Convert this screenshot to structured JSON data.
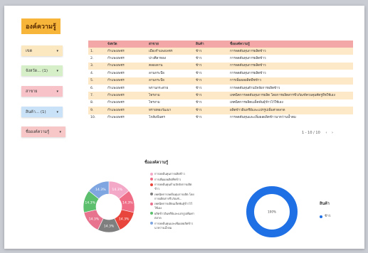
{
  "title": "องค์ความรู้",
  "filters": [
    {
      "label": "เขต",
      "bg": "#fbe7c0"
    },
    {
      "label": "จังหวัด... (1)",
      "bg": "#d7efc9"
    },
    {
      "label": "สาขาย",
      "bg": "#f7c2c8"
    },
    {
      "label": "สินค้า... (1)",
      "bg": "#c9e2f7"
    },
    {
      "label": "ชื่อองค์ความรู้",
      "bg": "#f7c7c7"
    }
  ],
  "table": {
    "headers": [
      "",
      "จังหวัด",
      "สาขาย",
      "สินค้า",
      "ชื่อองค์ความรู้"
    ],
    "rows": [
      [
        "1.",
        "กำแพงเพชร",
        "เมืองกำแพงเพชร",
        "ข้าว",
        "การลดต้นทุนการผลิตข้าว"
      ],
      [
        "2.",
        "กำแพงเพชร",
        "ปางศิลาทอง",
        "ข้าว",
        "การลดต้นทุนการผลิตข้าว"
      ],
      [
        "3.",
        "กำแพงเพชร",
        "คลองลาน",
        "ข้าว",
        "การลดต้นทุนการผลิตข้าว"
      ],
      [
        "4.",
        "กำแพงเพชร",
        "ลานกระบือ",
        "ข้าว",
        "การลดต้นทุนการผลิตข้าว"
      ],
      [
        "5.",
        "กำแพงเพชร",
        "ลานกระบือ",
        "ข้าว",
        "การเพิ่มผลผลิตพืชข้าว"
      ],
      [
        "6.",
        "กำแพงเพชร",
        "พรานกระต่าย",
        "ข้าว",
        "การลดต้นทุนด้านปัจจัยการผลิตข้าว"
      ],
      [
        "7.",
        "กำแพงเพชร",
        "ไทรงาม",
        "ข้าว",
        "เทคนิคการลดต้นทุนการผลิต โดยการผลิตสารชีวภัณฑ์ควบคุมศัตรูพืชใช้เอง"
      ],
      [
        "8.",
        "กำแพงเพชร",
        "ไทรงาม",
        "ข้าว",
        "เทคนิคการผลิตเมล็ดพันธุ์ข้าวไว้ใช้เอง"
      ],
      [
        "9.",
        "กำแพงเพชร",
        "ทรายทองวัฒนา",
        "ข้าว",
        "ผลิตข้าวอินทรีย์และแปรรูปเพิ่มค่าตลาด"
      ],
      [
        "10.",
        "กำแพงเพชร",
        "โกสัมพีนคร",
        "ข้าว",
        "การลดต้นทุนและเพิ่มผลผลิตข้าวนาหว่านน้ำตม"
      ]
    ]
  },
  "pagination": {
    "text": "1 - 10 / 10"
  },
  "pie_title": "ชื่อองค์ความรู้",
  "donut_title": "สินค้า",
  "chart_data": [
    {
      "type": "pie",
      "title": "ชื่อองค์ความรู้",
      "donut": true,
      "labels": [
        "การลดต้นทุนการผลิตข้าว",
        "การเพิ่มผลผลิตพืชข้าว",
        "การลดต้นทุนด้านปัจจัยการผลิตข้าว",
        "เทคนิคการลดต้นทุนการผลิต โดยการผลิตสารชีวภัณฑ์...",
        "เทคนิคการผลิตเมล็ดพันธุ์ข้าวไว้ใช้เอง",
        "ผลิตข้าวอินทรีย์และแปรรูปเพิ่มค่าตลาด",
        "การลดต้นทุนและเพิ่มผลผลิตข้าวนาหว่านน้ำตม"
      ],
      "values": [
        14.3,
        14.3,
        14.3,
        14.3,
        14.3,
        14.3,
        14.3
      ],
      "value_labels": [
        "14.3%",
        "14.3%",
        "14.3%",
        "14.3%",
        "14.3%",
        "14.3%",
        "14.3%"
      ],
      "colors": [
        "#f4a8c8",
        "#ef6d87",
        "#e8453c",
        "#7f7f7f",
        "#e7738e",
        "#5bbf6e",
        "#7fa6e0"
      ]
    },
    {
      "type": "pie",
      "title": "สินค้า",
      "donut": true,
      "labels": [
        "ข้าว"
      ],
      "values": [
        100
      ],
      "value_labels": [
        "100%"
      ],
      "colors": [
        "#1f6fe5"
      ]
    }
  ]
}
